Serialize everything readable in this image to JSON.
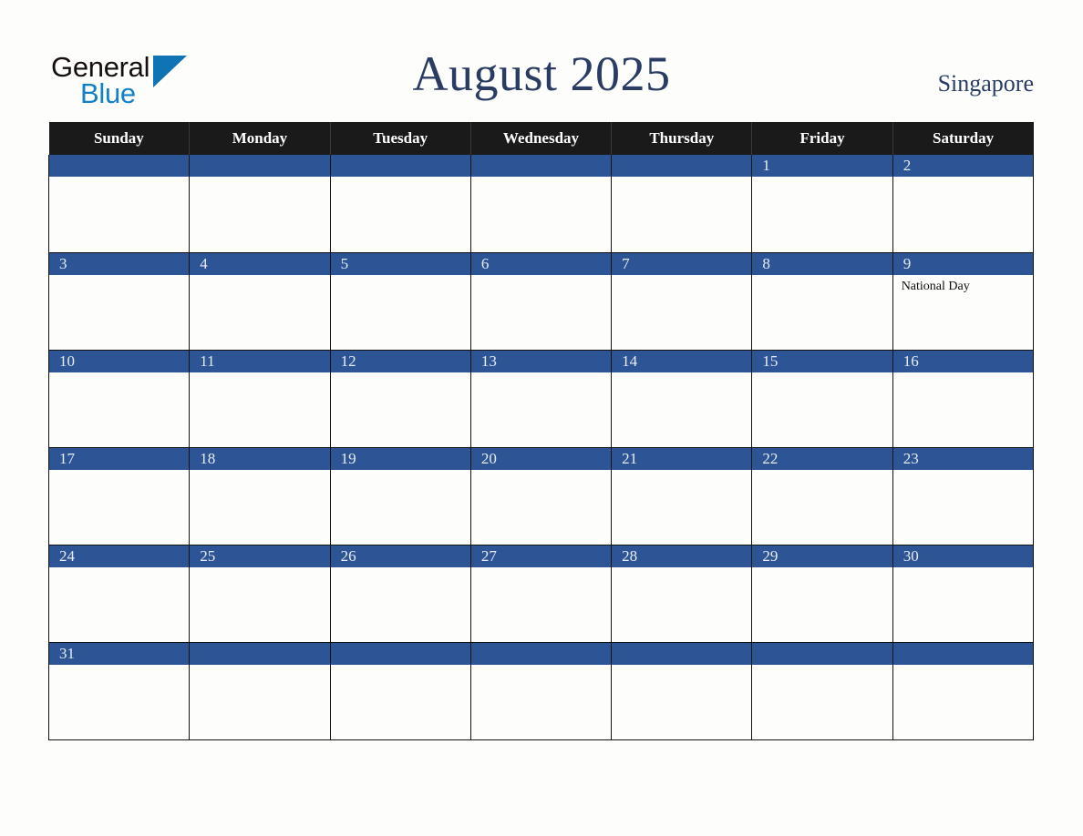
{
  "header": {
    "logo": {
      "text_primary": "General",
      "text_secondary": "Blue",
      "triangle_color": "#1073b4",
      "primary_color": "#15100f",
      "secondary_color": "#1281c6"
    },
    "title": "August 2025",
    "country": "Singapore",
    "title_color": "#2a3c63"
  },
  "calendar": {
    "weekday_headers": [
      "Sunday",
      "Monday",
      "Tuesday",
      "Wednesday",
      "Thursday",
      "Friday",
      "Saturday"
    ],
    "header_bg": "#1a1a1a",
    "daynum_bg": "#2d5596",
    "daynum_color": "#e8ecf3",
    "weeks": [
      [
        {
          "day": "",
          "event": ""
        },
        {
          "day": "",
          "event": ""
        },
        {
          "day": "",
          "event": ""
        },
        {
          "day": "",
          "event": ""
        },
        {
          "day": "",
          "event": ""
        },
        {
          "day": "1",
          "event": ""
        },
        {
          "day": "2",
          "event": ""
        }
      ],
      [
        {
          "day": "3",
          "event": ""
        },
        {
          "day": "4",
          "event": ""
        },
        {
          "day": "5",
          "event": ""
        },
        {
          "day": "6",
          "event": ""
        },
        {
          "day": "7",
          "event": ""
        },
        {
          "day": "8",
          "event": ""
        },
        {
          "day": "9",
          "event": "National Day"
        }
      ],
      [
        {
          "day": "10",
          "event": ""
        },
        {
          "day": "11",
          "event": ""
        },
        {
          "day": "12",
          "event": ""
        },
        {
          "day": "13",
          "event": ""
        },
        {
          "day": "14",
          "event": ""
        },
        {
          "day": "15",
          "event": ""
        },
        {
          "day": "16",
          "event": ""
        }
      ],
      [
        {
          "day": "17",
          "event": ""
        },
        {
          "day": "18",
          "event": ""
        },
        {
          "day": "19",
          "event": ""
        },
        {
          "day": "20",
          "event": ""
        },
        {
          "day": "21",
          "event": ""
        },
        {
          "day": "22",
          "event": ""
        },
        {
          "day": "23",
          "event": ""
        }
      ],
      [
        {
          "day": "24",
          "event": ""
        },
        {
          "day": "25",
          "event": ""
        },
        {
          "day": "26",
          "event": ""
        },
        {
          "day": "27",
          "event": ""
        },
        {
          "day": "28",
          "event": ""
        },
        {
          "day": "29",
          "event": ""
        },
        {
          "day": "30",
          "event": ""
        }
      ],
      [
        {
          "day": "31",
          "event": ""
        },
        {
          "day": "",
          "event": ""
        },
        {
          "day": "",
          "event": ""
        },
        {
          "day": "",
          "event": ""
        },
        {
          "day": "",
          "event": ""
        },
        {
          "day": "",
          "event": ""
        },
        {
          "day": "",
          "event": ""
        }
      ]
    ]
  }
}
